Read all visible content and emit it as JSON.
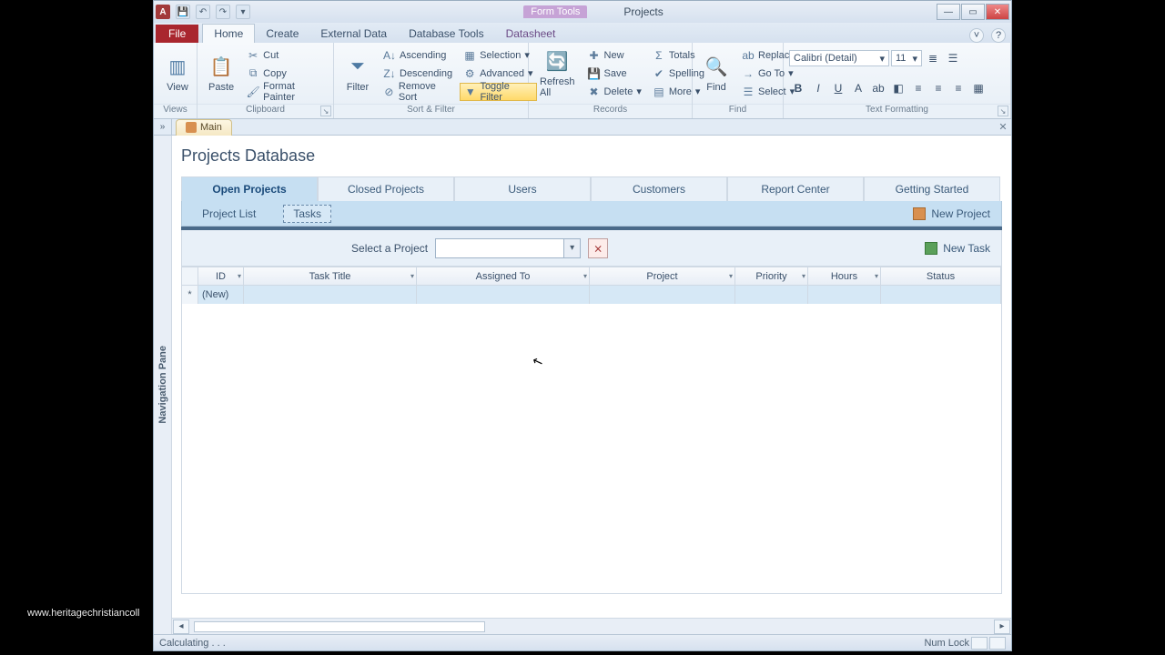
{
  "window": {
    "context_group": "Form Tools",
    "doc_title": "Projects",
    "qat": {
      "save": "💾",
      "undo": "↶",
      "redo": "↷",
      "more": "▾"
    }
  },
  "ribbon": {
    "file": "File",
    "tabs": [
      "Home",
      "Create",
      "External Data",
      "Database Tools",
      "Datasheet"
    ],
    "active": "Home",
    "groups": {
      "views_label": "Views",
      "view": "View",
      "clipboard_label": "Clipboard",
      "paste": "Paste",
      "cut": "Cut",
      "copy": "Copy",
      "format_painter": "Format Painter",
      "sort_filter_label": "Sort & Filter",
      "filter": "Filter",
      "asc": "Ascending",
      "desc": "Descending",
      "remove_sort": "Remove Sort",
      "selection": "Selection",
      "advanced": "Advanced",
      "toggle_filter": "Toggle Filter",
      "records_label": "Records",
      "refresh": "Refresh All",
      "new": "New",
      "save": "Save",
      "delete": "Delete",
      "totals": "Totals",
      "spelling": "Spelling",
      "more": "More",
      "find_label": "Find",
      "find": "Find",
      "replace": "Replace",
      "goto": "Go To",
      "select": "Select",
      "text_label": "Text Formatting",
      "font": "Calibri (Detail)",
      "size": "11"
    }
  },
  "object_tab": {
    "name": "Main"
  },
  "nav_pane_label": "Navigation Pane",
  "page": {
    "title": "Projects Database",
    "tabs": [
      "Open Projects",
      "Closed Projects",
      "Users",
      "Customers",
      "Report Center",
      "Getting Started"
    ],
    "subtabs": {
      "project_list": "Project List",
      "tasks": "Tasks"
    },
    "new_project": "New Project",
    "select_project_label": "Select a Project",
    "new_task": "New Task"
  },
  "grid": {
    "columns": [
      "ID",
      "Task Title",
      "Assigned To",
      "Project",
      "Priority",
      "Hours",
      "Status"
    ],
    "new_row": "(New)"
  },
  "status": {
    "left": "Calculating . . .",
    "numlock": "Num Lock"
  },
  "watermark": "www.heritagechristiancoll"
}
